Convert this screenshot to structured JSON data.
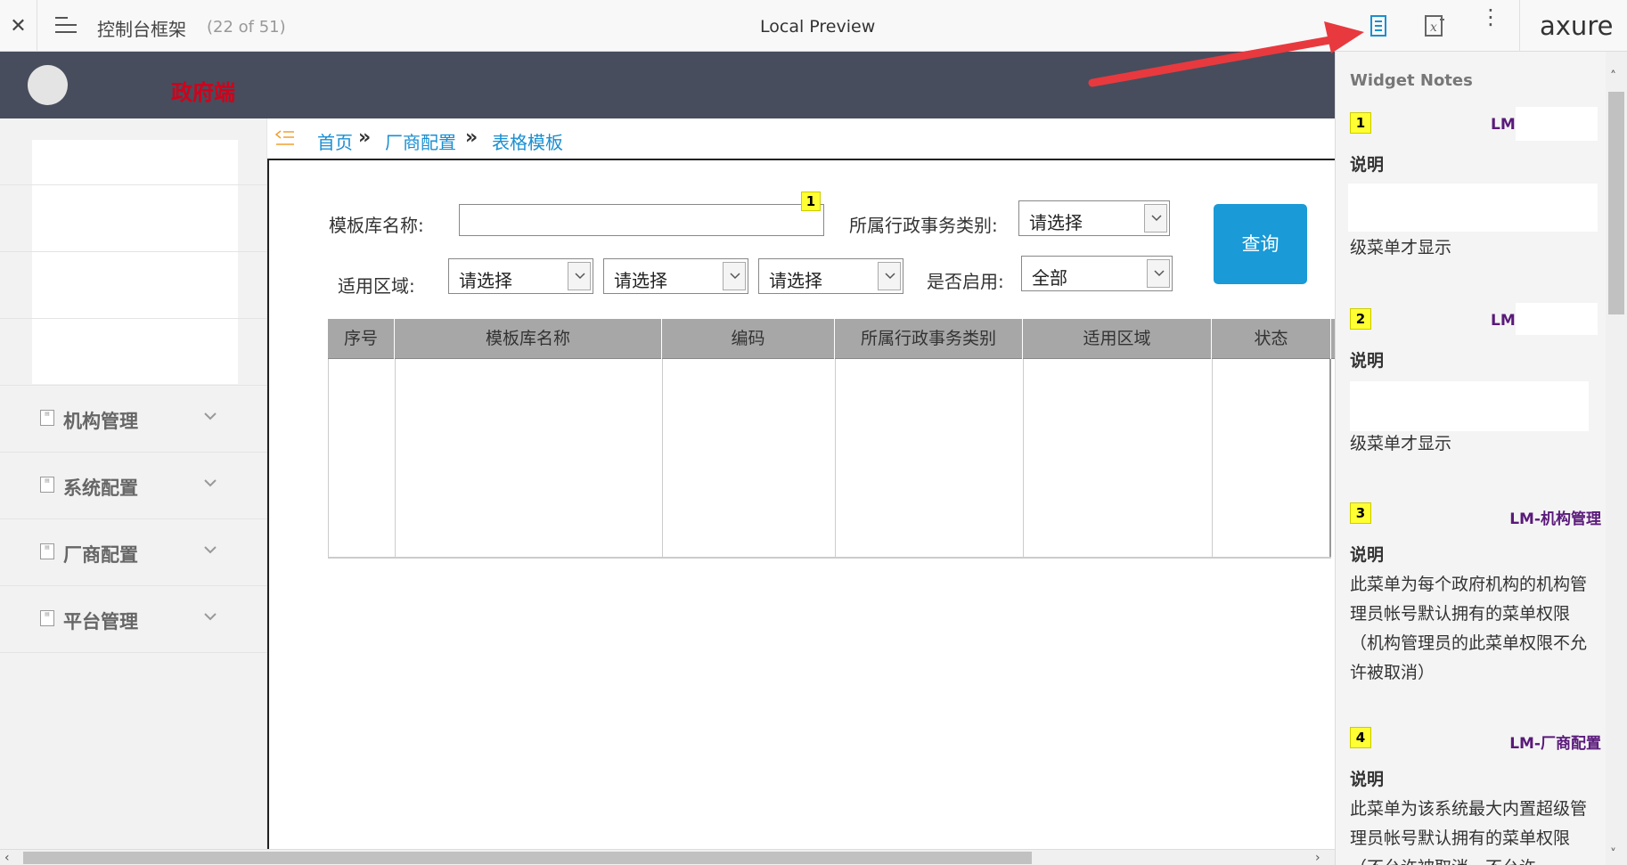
{
  "toolbar": {
    "close_glyph": "✕",
    "page_title": "控制台框架",
    "page_count": "(22 of 51)",
    "center_title": "Local Preview",
    "more_glyph": "⋮",
    "logo": "axure"
  },
  "header": {
    "brand": "政府端"
  },
  "sidebar": {
    "items": [
      {
        "label": "机构管理",
        "icon": "menu-doc-icon"
      },
      {
        "label": "系统配置",
        "icon": "menu-doc-icon"
      },
      {
        "label": "厂商配置",
        "icon": "menu-doc-icon"
      },
      {
        "label": "平台管理",
        "icon": "menu-doc-icon"
      }
    ]
  },
  "breadcrumb": {
    "items": [
      "首页",
      "厂商配置",
      "表格模板"
    ],
    "separator": "»"
  },
  "form": {
    "template_name_label": "模板库名称:",
    "template_name_value": "",
    "note_flag": "1",
    "category_label": "所属行政事务类别:",
    "category_value": "请选择",
    "region_label": "适用区域:",
    "region_values": [
      "请选择",
      "请选择",
      "请选择"
    ],
    "enabled_label": "是否启用:",
    "enabled_value": "全部",
    "query_button": "查询"
  },
  "table": {
    "columns": [
      "序号",
      "模板库名称",
      "编码",
      "所属行政事务类别",
      "适用区域",
      "状态"
    ],
    "rows": []
  },
  "notes_panel": {
    "title": "Widget Notes",
    "notes": [
      {
        "num": "1",
        "title": "LM-",
        "label": "说明",
        "body": "级菜单才显示"
      },
      {
        "num": "2",
        "title": "LM-",
        "label": "说明",
        "body": "级菜单才显示"
      },
      {
        "num": "3",
        "title": "LM-机构管理",
        "label": "说明",
        "body": "此菜单为每个政府机构的机构管理员帐号默认拥有的菜单权限（机构管理员的此菜单权限不允许被取消）"
      },
      {
        "num": "4",
        "title": "LM-厂商配置",
        "label": "说明",
        "body": "此菜单为该系统最大内置超级管理员帐号默认拥有的菜单权限（不允许被取消，不允许"
      }
    ]
  },
  "colors": {
    "header_bg": "#474d5c",
    "brand_red": "#d0021b",
    "link_blue": "#1a8fd1",
    "query_blue": "#1a9ad6",
    "note_title_purple": "#5a1a7a",
    "annotation_arrow": "#e8393f"
  }
}
